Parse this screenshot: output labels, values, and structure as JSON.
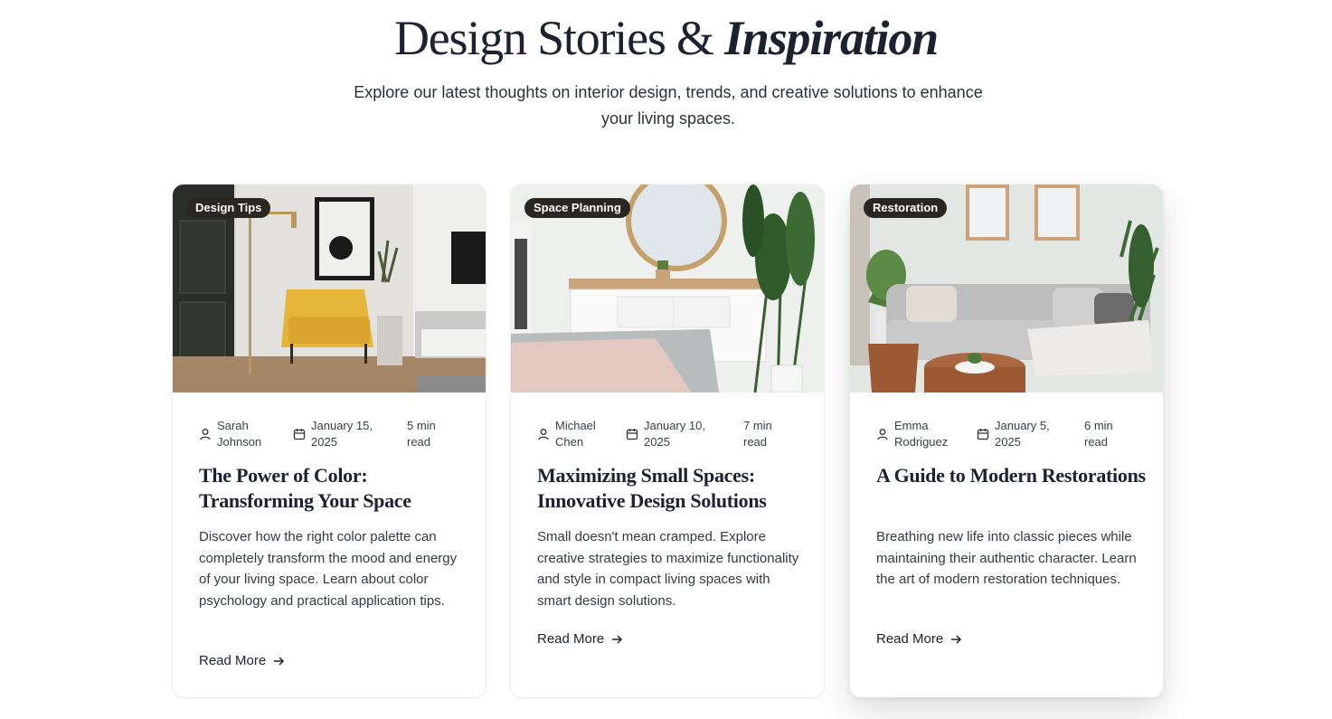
{
  "hero": {
    "title_main": "Design Stories & ",
    "title_emphasis": "Inspiration",
    "subtitle": "Explore our latest thoughts on interior design, trends, and creative solutions to enhance your living spaces."
  },
  "posts": [
    {
      "category": "Design Tips",
      "author": "Sarah Johnson",
      "date": "January 15, 2025",
      "read_time": "5 min read",
      "title": "The Power of Color: Transforming Your Space",
      "excerpt": "Discover how the right color palette can completely transform the mood and energy of your living space. Learn about color psychology and practical application tips.",
      "cta": "Read More"
    },
    {
      "category": "Space Planning",
      "author": "Michael Chen",
      "date": "January 10, 2025",
      "read_time": "7 min read",
      "title": "Maximizing Small Spaces: Innovative Design Solutions",
      "excerpt": "Small doesn't mean cramped. Explore creative strategies to maximize functionality and style in compact living spaces with smart design solutions.",
      "cta": "Read More"
    },
    {
      "category": "Restoration",
      "author": "Emma Rodriguez",
      "date": "January 5, 2025",
      "read_time": "6 min read",
      "title": "A Guide to Modern Restorations",
      "excerpt": "Breathing new life into classic pieces while maintaining their authentic character. Learn the art of modern restoration techniques.",
      "cta": "Read More"
    }
  ],
  "icons": {
    "author": "user-icon",
    "date": "calendar-icon",
    "cta": "arrow-right-icon"
  },
  "colors": {
    "badge_bg": "#2a2622",
    "heading": "#1d2230",
    "body_text": "#353a42"
  }
}
